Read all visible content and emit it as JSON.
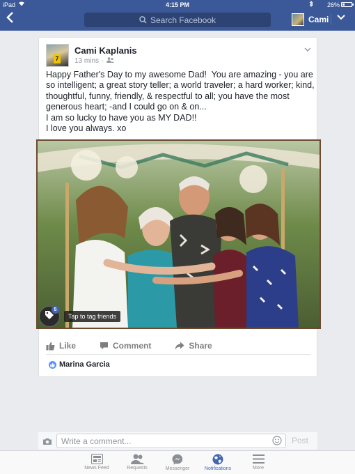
{
  "status_bar": {
    "carrier": "iPad",
    "time": "4:15 PM",
    "battery_percent": "26%",
    "battery_level": 0.26
  },
  "nav": {
    "search_placeholder": "Search Facebook",
    "profile_name": "Cami"
  },
  "post": {
    "author": "Cami Kaplanis",
    "timestamp": "13 mins",
    "audience_icon": "friends-icon",
    "text": "Happy Father's Day to my awesome Dad!  You are amazing - you are so intelligent; a great story teller; a world traveler; a hard worker; kind, thoughtful, funny, friendly, & respectful to all; you have the most generous heart; -and I could go on & on...\nI am so lucky to have you as MY DAD!!\nI love you always. xo",
    "tag_count": "5",
    "tag_tooltip": "Tap to tag friends",
    "actions": {
      "like": "Like",
      "comment": "Comment",
      "share": "Share"
    },
    "liked_by": "Marina Garcia"
  },
  "comment_bar": {
    "placeholder": "Write a comment...",
    "post_label": "Post"
  },
  "tabs": [
    {
      "label": "News Feed",
      "icon": "news-feed-icon",
      "active": false
    },
    {
      "label": "Requests",
      "icon": "friend-requests-icon",
      "active": false
    },
    {
      "label": "Messenger",
      "icon": "messenger-icon",
      "active": false
    },
    {
      "label": "Notifications",
      "icon": "globe-icon",
      "active": true
    },
    {
      "label": "More",
      "icon": "menu-icon",
      "active": false
    }
  ],
  "colors": {
    "brand": "#3b5998",
    "active_tab": "#4267b2",
    "like_blue": "#5890ff"
  }
}
